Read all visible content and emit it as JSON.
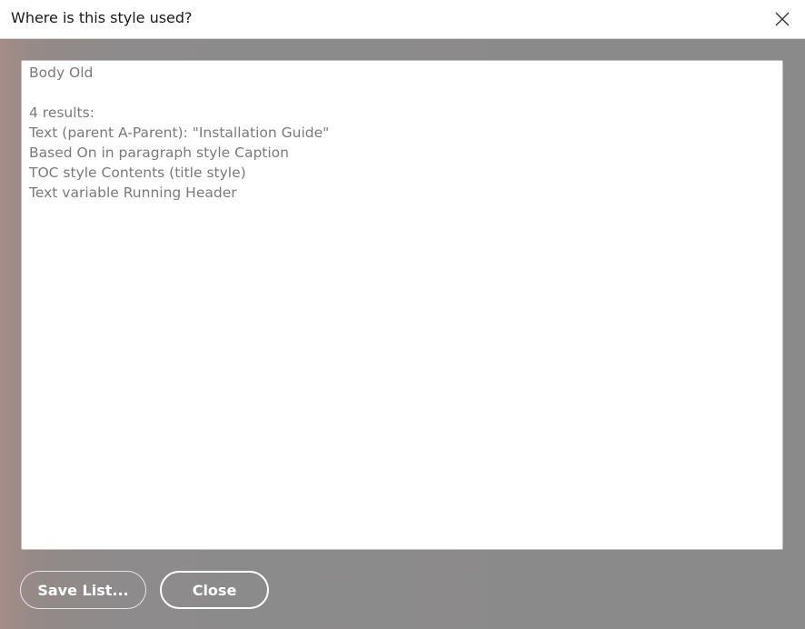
{
  "dialog": {
    "title": "Where is this style used?",
    "close_icon": "close-icon"
  },
  "results": {
    "lines": [
      "Body Old",
      "",
      "4 results:",
      "Text (parent A-Parent): \"Installation Guide\"",
      "Based On in paragraph style Caption",
      "TOC style Contents (title style)",
      "Text variable Running Header"
    ]
  },
  "buttons": {
    "save_list_label": "Save List...",
    "close_label": "Close"
  },
  "colors": {
    "titlebar": "#ffffff",
    "dialog_background": "#8a8a8a",
    "text_muted": "#7a7a7a",
    "button_text": "#ffffff"
  }
}
